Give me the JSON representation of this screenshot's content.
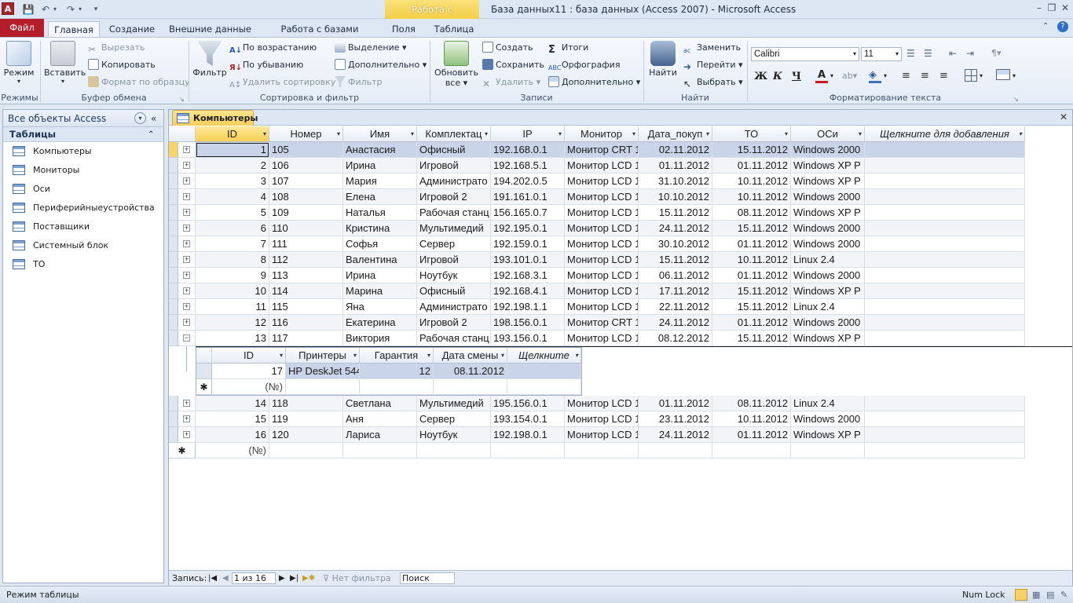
{
  "titlebar": {
    "app_icon": "A",
    "context_tab": "Работа с таблицами",
    "title": "База данных11 : база данных (Access 2007)  -  Microsoft Access"
  },
  "tabs": {
    "file": "Файл",
    "items": [
      "Главная",
      "Создание",
      "Внешние данные",
      "Работа с базами данных",
      "Поля",
      "Таблица"
    ]
  },
  "ribbon": {
    "views": {
      "mode": "Режим",
      "label": "Режимы"
    },
    "clipboard": {
      "paste": "Вставить",
      "cut": "Вырезать",
      "copy": "Копировать",
      "format": "Формат по образцу",
      "label": "Буфер обмена"
    },
    "sort": {
      "filter": "Фильтр",
      "asc": "По возрастанию",
      "desc": "По убыванию",
      "remove": "Удалить сортировку",
      "selection": "Выделение",
      "advanced": "Дополнительно",
      "toggle": "Фильтр",
      "label": "Сортировка и фильтр"
    },
    "records": {
      "refresh1": "Обновить",
      "refresh2": "все",
      "create": "Создать",
      "save": "Сохранить",
      "delete": "Удалить",
      "totals": "Итоги",
      "spelling": "Орфография",
      "more": "Дополнительно",
      "label": "Записи"
    },
    "find": {
      "find": "Найти",
      "replace": "Заменить",
      "goto": "Перейти",
      "select": "Выбрать",
      "label": "Найти"
    },
    "text": {
      "font": "Calibri",
      "size": "11",
      "bold": "Ж",
      "italic": "К",
      "underline": "Ч",
      "label": "Форматирование текста"
    }
  },
  "nav": {
    "header": "Все объекты Access",
    "section": "Таблицы",
    "items": [
      "Компьютеры",
      "Мониторы",
      "Оси",
      "Периферийныеустройства",
      "Поставщики",
      "Системный блок",
      "ТО"
    ]
  },
  "doc": {
    "tab": "Компьютеры"
  },
  "grid": {
    "columns": [
      "ID",
      "Номер",
      "Имя",
      "Комплектац",
      "IP",
      "Монитор",
      "Дата_покуп",
      "ТО",
      "ОСи",
      "Щелкните для добавления"
    ],
    "rows": [
      [
        "1",
        "105",
        "Анастасия",
        "Офисный",
        "192.168.0.1",
        "Монитор CRT 1",
        "02.11.2012",
        "15.11.2012",
        "Windows 2000"
      ],
      [
        "2",
        "106",
        "Ирина",
        "Игровой",
        "192.168.5.1",
        "Монитор LCD 1",
        "01.11.2012",
        "01.11.2012",
        "Windows XP P"
      ],
      [
        "3",
        "107",
        "Мария",
        "Администрато",
        "194.202.0.5",
        "Монитор LCD 1",
        "31.10.2012",
        "10.11.2012",
        "Windows XP P"
      ],
      [
        "4",
        "108",
        "Елена",
        "Игровой 2",
        "191.161.0.1",
        "Монитор LCD 1",
        "10.10.2012",
        "10.11.2012",
        "Windows 2000"
      ],
      [
        "5",
        "109",
        "Наталья",
        "Рабочая станц",
        "156.165.0.7",
        "Монитор LCD 1",
        "15.11.2012",
        "08.11.2012",
        "Windows XP P"
      ],
      [
        "6",
        "110",
        "Кристина",
        "Мультимедий",
        "192.195.0.1",
        "Монитор LCD 1",
        "24.11.2012",
        "15.11.2012",
        "Windows 2000"
      ],
      [
        "7",
        "111",
        "Софья",
        "Сервер",
        "192.159.0.1",
        "Монитор LCD 1",
        "30.10.2012",
        "01.11.2012",
        "Windows 2000"
      ],
      [
        "8",
        "112",
        "Валентина",
        "Игровой",
        "193.101.0.1",
        "Монитор LCD 1",
        "15.11.2012",
        "10.11.2012",
        "Linux 2.4"
      ],
      [
        "9",
        "113",
        "Ирина",
        "Ноутбук",
        "192.168.3.1",
        "Монитор LCD 1",
        "06.11.2012",
        "01.11.2012",
        "Windows 2000"
      ],
      [
        "10",
        "114",
        "Марина",
        "Офисный",
        "192.168.4.1",
        "Монитор LCD 1",
        "17.11.2012",
        "15.11.2012",
        "Windows XP P"
      ],
      [
        "11",
        "115",
        "Яна",
        "Администрато",
        "192.198.1.1",
        "Монитор LCD 1",
        "22.11.2012",
        "15.11.2012",
        "Linux 2.4"
      ],
      [
        "12",
        "116",
        "Екатерина",
        "Игровой 2",
        "198.156.0.1",
        "Монитор CRT 1",
        "24.11.2012",
        "01.11.2012",
        "Windows 2000"
      ],
      [
        "13",
        "117",
        "Виктория",
        "Рабочая станц",
        "193.156.0.1",
        "Монитор LCD 1",
        "08.12.2012",
        "15.11.2012",
        "Windows XP P"
      ],
      [
        "14",
        "118",
        "Светлана",
        "Мультимедий",
        "195.156.0.1",
        "Монитор LCD 1",
        "01.11.2012",
        "08.11.2012",
        "Linux 2.4"
      ],
      [
        "15",
        "119",
        "Аня",
        "Сервер",
        "193.154.0.1",
        "Монитор LCD 1",
        "23.11.2012",
        "10.11.2012",
        "Windows 2000"
      ],
      [
        "16",
        "120",
        "Лариса",
        "Ноутбук",
        "192.198.0.1",
        "Монитор LCD 1",
        "24.11.2012",
        "01.11.2012",
        "Windows XP P"
      ]
    ],
    "new_row": "(№)",
    "subgrid": {
      "columns": [
        "ID",
        "Принтеры",
        "Гарантия",
        "Дата смены",
        "Щелкните"
      ],
      "rows": [
        [
          "17",
          "HP DeskJet 544",
          "12",
          "08.11.2012"
        ]
      ],
      "new_row": "(№)"
    }
  },
  "recnav": {
    "label": "Запись:",
    "position": "1 из 16",
    "filter": "Нет фильтра",
    "search": "Поиск"
  },
  "status": {
    "left": "Режим таблицы",
    "numlock": "Num Lock"
  }
}
